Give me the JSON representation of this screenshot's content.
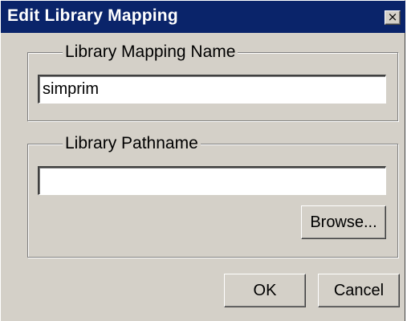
{
  "window": {
    "title": "Edit Library Mapping",
    "close_glyph": "×"
  },
  "mapping_group": {
    "legend": "Library Mapping Name",
    "value": "simprim"
  },
  "path_group": {
    "legend": "Library Pathname",
    "value": "",
    "browse_label": "Browse..."
  },
  "buttons": {
    "ok_label": "OK",
    "cancel_label": "Cancel"
  },
  "colors": {
    "title_bar": "#0a246a",
    "dialog_face": "#d4d0c8"
  },
  "icons": {
    "close": "close-icon"
  }
}
